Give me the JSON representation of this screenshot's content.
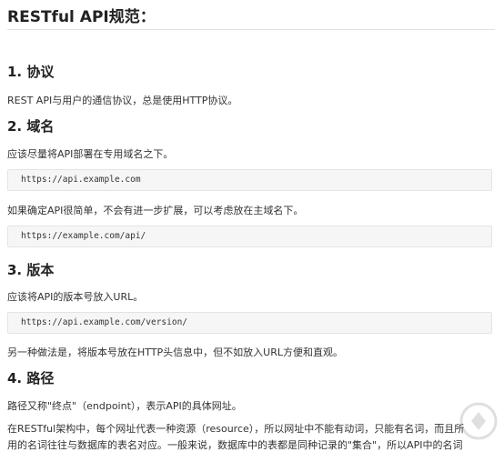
{
  "doc": {
    "title": "RESTful API规范：",
    "sections": [
      {
        "heading": "1. 协议",
        "paragraphs": [
          "REST API与用户的通信协议，总是使用HTTP协议。"
        ]
      },
      {
        "heading": "2. 域名",
        "paragraphs": [
          "应该尽量将API部署在专用域名之下。",
          "如果确定API很简单，不会有进一步扩展，可以考虑放在主域名下。"
        ],
        "code": [
          "https://api.example.com",
          "https://example.com/api/"
        ]
      },
      {
        "heading": "3. 版本",
        "paragraphs": [
          "应该将API的版本号放入URL。",
          "另一种做法是，将版本号放在HTTP头信息中，但不如放入URL方便和直观。"
        ],
        "code": [
          "https://api.example.com/version/"
        ]
      },
      {
        "heading": "4. 路径",
        "paragraphs": [
          "路径又称\"终点\"（endpoint），表示API的具体网址。",
          "在RESTful架构中，每个网址代表一种资源（resource），所以网址中不能有动词，只能有名词，而且所",
          "用的名词往往与数据库的表名对应。一般来说，数据库中的表都是同种记录的\"集合\"，所以API中的名词"
        ]
      }
    ]
  }
}
